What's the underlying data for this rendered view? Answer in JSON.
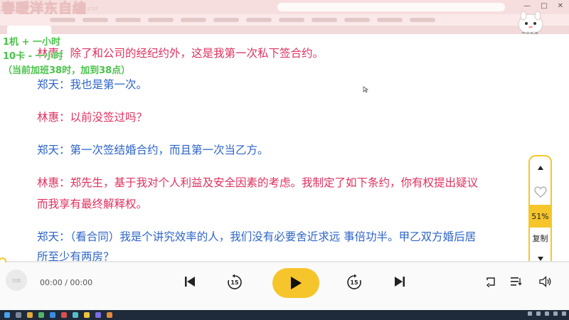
{
  "browser": {
    "title_overlay": "春暖洋东自编~",
    "mascot_label": "宝蓝新莲"
  },
  "overlay": {
    "line1": "1机 + 一小时",
    "line2": "10卡 - 一小时",
    "line3": "（当前加班38时，加到38点）"
  },
  "reader": {
    "lines": [
      {
        "text": "林惠：除了和公司的经纪约外，这是我第一次私下签合约。",
        "speaker": "林惠"
      },
      {
        "text": "郑天：我也是第一次。",
        "speaker": "郑天"
      },
      {
        "text": "林惠：以前没签过吗？",
        "speaker": "林惠"
      },
      {
        "text": "郑天：第一次签结婚合约，而且第一次当乙方。",
        "speaker": "郑天"
      },
      {
        "text": "林惠：郑先生，基于我对个人利益及安全因素的考虑。我制定了如下条约，你有权提出疑议",
        "speaker": "林惠"
      },
      {
        "text": "而我享有最终解释权。",
        "speaker": "林惠"
      },
      {
        "text": "郑天：（看合同）我是个讲究效率的人，我们没有必要舍近求远 事倍功半。甲乙双方婚后居",
        "speaker": "郑天"
      },
      {
        "text": "所至少有两房？",
        "speaker": "郑天"
      }
    ],
    "colors": {
      "lin_hui": "#e0315f",
      "zheng_tian": "#2d64c8"
    }
  },
  "side_panel": {
    "up_icon": "triangle-up-icon",
    "favorite_icon": "heart-icon",
    "percent": "51%",
    "copy_label": "复制",
    "down_icon": "triangle-down-icon"
  },
  "player": {
    "cover_label": "封面",
    "time": "00:00 / 00:00",
    "rewind_seconds": "15",
    "forward_seconds": "15",
    "progress": 0,
    "accent": "#f6c52b"
  }
}
